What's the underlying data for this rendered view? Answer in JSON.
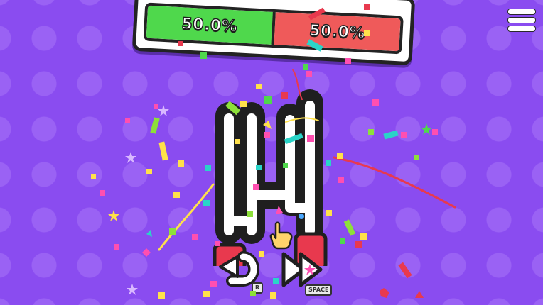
{
  "progress": {
    "left_percent_label": "50.0%",
    "right_percent_label": "50.0%",
    "left_fraction": 0.5,
    "right_fraction": 0.5,
    "left_color": "#4fd84c",
    "right_color": "#ef5a5a"
  },
  "menu": {
    "icon": "hamburger-menu-icon"
  },
  "controls": {
    "undo": {
      "icon": "undo-arrow-icon",
      "key_label": "R"
    },
    "skip": {
      "icon": "fast-forward-icon",
      "key_label": "SPACE"
    }
  },
  "colors": {
    "background": "#8a4cf0",
    "pattern": "#9a62f4",
    "path": "#ffffff",
    "outline": "#1f1f1f",
    "start_block": "#e8394e"
  }
}
